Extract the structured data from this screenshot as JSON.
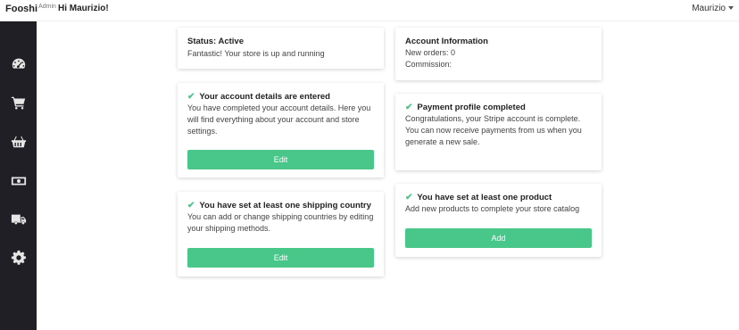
{
  "header": {
    "brand": "Fooshi",
    "brand_sub": "Admin",
    "greeting": "Hi Maurizio!",
    "user_name": "Maurizio"
  },
  "sidebar": {
    "items": [
      {
        "icon": "dashboard-icon"
      },
      {
        "icon": "cart-icon"
      },
      {
        "icon": "basket-icon"
      },
      {
        "icon": "money-icon"
      },
      {
        "icon": "truck-icon"
      },
      {
        "icon": "gear-icon"
      }
    ]
  },
  "cards": {
    "status": {
      "title": "Status: Active",
      "text": "Fantastic! Your store is up and running"
    },
    "account_info": {
      "title": "Account Information",
      "new_orders": "New orders: 0",
      "commission": "Commission:"
    },
    "account_details": {
      "title": "Your account details are entered",
      "text": "You have completed your account details. Here you will find everything about your account and store settings.",
      "button": "Edit"
    },
    "payment": {
      "title": "Payment profile completed",
      "text": "Congratulations, your Stripe account is complete. You can now receive payments from us when you generate a new sale."
    },
    "shipping": {
      "title": "You have set at least one shipping country",
      "text": "You can add or change shipping countries by editing your shipping methods.",
      "button": "Edit"
    },
    "product": {
      "title": "You have set at least one product",
      "text": "Add new products to complete your store catalog",
      "button": "Add"
    }
  },
  "colors": {
    "accent": "#49c78a",
    "sidebar_bg": "#1f1f25"
  }
}
